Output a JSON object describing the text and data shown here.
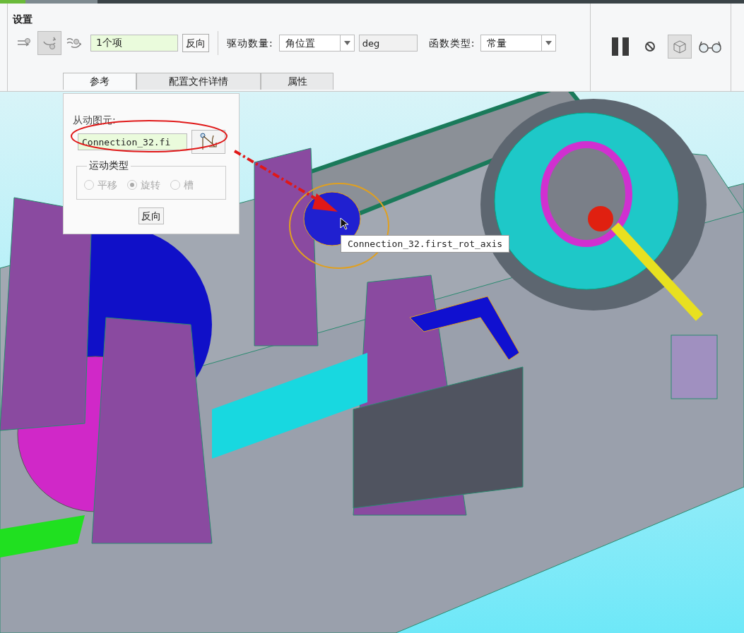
{
  "ribbon": {
    "group_title": "设置",
    "mode_buttons": [
      {
        "selected": false
      },
      {
        "selected": true
      },
      {
        "selected": false
      }
    ],
    "reference_field": {
      "value": "1个项"
    },
    "reverse_button": "反向",
    "drive_quantity": {
      "label": "驱动数量:",
      "value": "角位置",
      "unit": "deg"
    },
    "function_type": {
      "label": "函数类型:",
      "value": "常量"
    },
    "right_tools": [
      {
        "kind": "pause",
        "selected": false
      },
      {
        "kind": "no",
        "selected": false
      },
      {
        "kind": "model",
        "selected": true
      },
      {
        "kind": "glasses",
        "selected": false
      }
    ]
  },
  "tabs": [
    {
      "label": "参考",
      "selected": true
    },
    {
      "label": "配置文件详情",
      "selected": false
    },
    {
      "label": "属性",
      "selected": false
    }
  ],
  "panel": {
    "driven_label": "从动图元:",
    "driven_value": "Connection_32.fi",
    "motion_type": {
      "title": "运动类型",
      "options": [
        {
          "label": "平移",
          "selected": false,
          "disabled": true
        },
        {
          "label": "旋转",
          "selected": true,
          "disabled": true
        },
        {
          "label": "槽",
          "selected": false,
          "disabled": true
        }
      ]
    },
    "reverse_button": "反向"
  },
  "tooltip": "Connection_32.first_rot_axis"
}
